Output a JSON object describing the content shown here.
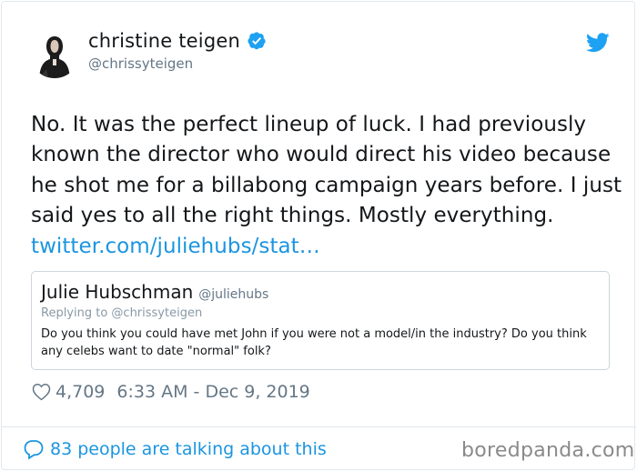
{
  "author": {
    "name": "christine teigen",
    "handle": "@chrissyteigen",
    "verified": true
  },
  "tweet": {
    "text": "No. It was the perfect lineup of luck. I had previously known the director who would direct his video because he shot me for a billabong campaign years before. I just said yes to all the right things. Mostly everything. ",
    "link": "twitter.com/juliehubs/stat…"
  },
  "quoted": {
    "name": "Julie Hubschman",
    "handle": "@juliehubs",
    "reply_to": "Replying to @chrissyteigen",
    "text": "Do you think you could have met John if you were not a model/in the industry? Do you think any celebs want to date \"normal\" folk?"
  },
  "stats": {
    "likes": "4,709",
    "timestamp": "6:33 AM - Dec 9, 2019"
  },
  "footer": {
    "talking": "83 people are talking about this",
    "watermark": "boredpanda.com"
  },
  "colors": {
    "twitter_blue": "#1da1f2",
    "link_blue": "#1b95e0",
    "text": "#14171a",
    "muted": "#657786",
    "border": "#e1e8ed"
  },
  "icons": {
    "verified": "verified-badge-icon",
    "logo": "twitter-bird-icon",
    "like": "heart-icon",
    "comment": "speech-bubble-icon"
  }
}
